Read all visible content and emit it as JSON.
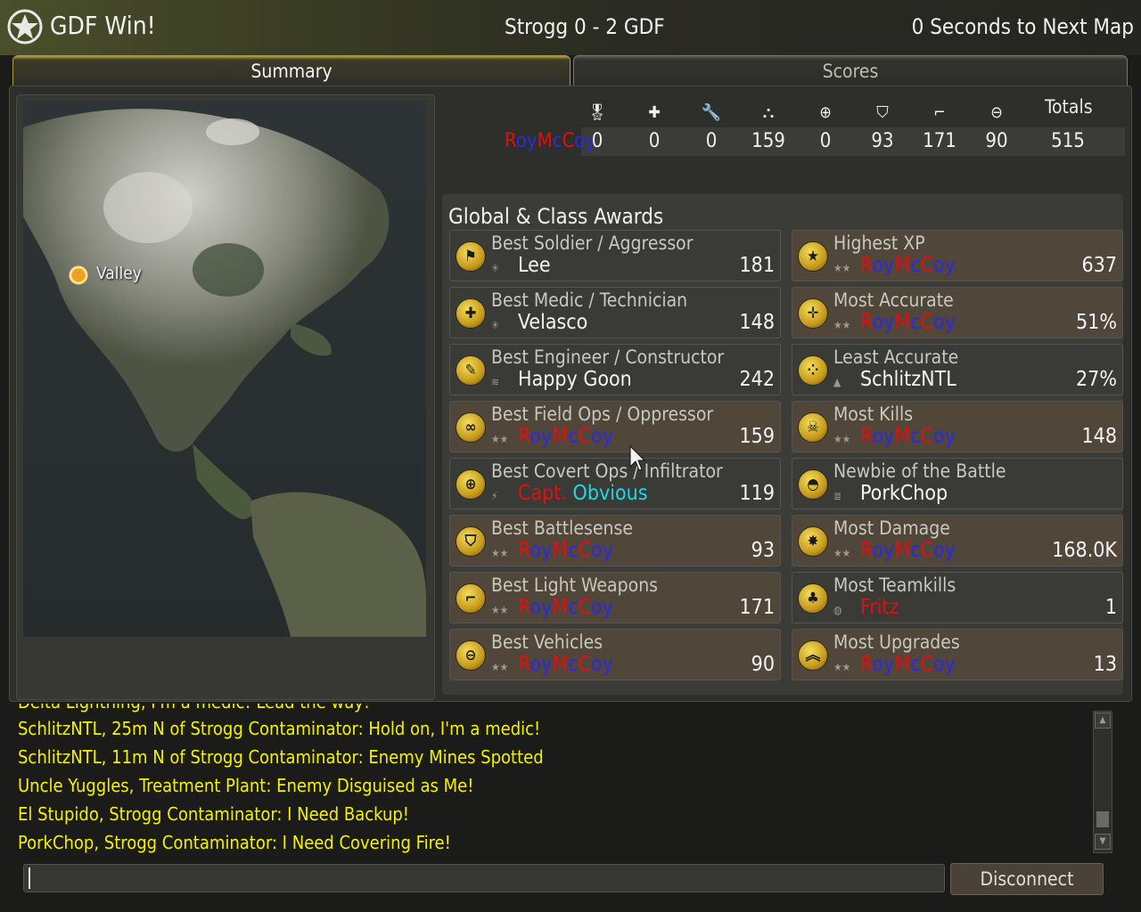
{
  "header": {
    "result": "GDF Win!",
    "match_score": "Strogg 0 - 2 GDF",
    "next_map": "0 Seconds to Next Map"
  },
  "tabs": [
    {
      "label": "Summary",
      "active": true
    },
    {
      "label": "Scores",
      "active": false
    }
  ],
  "map": {
    "location_label": "Valley"
  },
  "score_table": {
    "columns": [
      "soldier-icon",
      "medic-cross-icon",
      "wrench-icon",
      "binoculars-icon",
      "crosshair-icon",
      "shield-icon",
      "pistol-icon",
      "wheel-icon"
    ],
    "totals_label": "Totals",
    "player": {
      "name_parts": [
        {
          "text": "R",
          "color": "#e01010"
        },
        {
          "text": "oy",
          "color": "#2a2ae6"
        },
        {
          "text": "M",
          "color": "#e01010"
        },
        {
          "text": "c",
          "color": "#2a2ae6"
        },
        {
          "text": "C",
          "color": "#e01010"
        },
        {
          "text": "oy",
          "color": "#2a2ae6"
        }
      ],
      "values": [
        "0",
        "0",
        "0",
        "159",
        "0",
        "93",
        "171",
        "90"
      ],
      "total": "515"
    }
  },
  "awards": {
    "title": "Global & Class Awards",
    "left": [
      {
        "title": "Best Soldier / Aggressor",
        "player": "Lee",
        "value": "181",
        "rank_icon": "star-badge-icon",
        "icon": "soldier-icon",
        "alt": false
      },
      {
        "title": "Best Medic / Technician",
        "player": "Velasco",
        "value": "148",
        "rank_icon": "star-badge-icon",
        "icon": "medic-cross-icon",
        "alt": false
      },
      {
        "title": "Best Engineer / Constructor",
        "player": "Happy Goon",
        "value": "242",
        "rank_icon": "wings-badge-icon",
        "icon": "wrench-icon",
        "alt": false
      },
      {
        "title": "Best Field Ops / Oppressor",
        "player": "RoyMcCoy",
        "value": "159",
        "rank_icon": "two-stars-icon",
        "icon": "binoculars-icon",
        "alt": true
      },
      {
        "title": "Best Covert Ops / Infiltrator",
        "player": "Capt. Obvious",
        "value": "119",
        "rank_icon": "wing-badge-icon",
        "icon": "crosshair-icon",
        "alt": false
      },
      {
        "title": "Best Battlesense",
        "player": "RoyMcCoy",
        "value": "93",
        "rank_icon": "two-stars-icon",
        "icon": "shield-icon",
        "alt": true
      },
      {
        "title": "Best Light Weapons",
        "player": "RoyMcCoy",
        "value": "171",
        "rank_icon": "two-stars-icon",
        "icon": "pistol-icon",
        "alt": true
      },
      {
        "title": "Best Vehicles",
        "player": "RoyMcCoy",
        "value": "90",
        "rank_icon": "two-stars-icon",
        "icon": "wheel-icon",
        "alt": true
      }
    ],
    "right": [
      {
        "title": "Highest XP",
        "player": "RoyMcCoy",
        "value": "637",
        "rank_icon": "two-stars-icon",
        "icon": "star-icon",
        "alt": true
      },
      {
        "title": "Most Accurate",
        "player": "RoyMcCoy",
        "value": "51%",
        "rank_icon": "two-stars-icon",
        "icon": "target-icon",
        "alt": true
      },
      {
        "title": "Least Accurate",
        "player": "SchlitzNTL",
        "value": "27%",
        "rank_icon": "chevron-badge-icon",
        "icon": "dots-icon",
        "alt": false
      },
      {
        "title": "Most Kills",
        "player": "RoyMcCoy",
        "value": "148",
        "rank_icon": "two-stars-icon",
        "icon": "skull-icon",
        "alt": true
      },
      {
        "title": "Newbie of the Battle",
        "player": "PorkChop",
        "value": "",
        "rank_icon": "private-badge-icon",
        "icon": "helmet-icon",
        "alt": false
      },
      {
        "title": "Most Damage",
        "player": "RoyMcCoy",
        "value": "168.0K",
        "rank_icon": "two-stars-icon",
        "icon": "explosion-icon",
        "alt": true
      },
      {
        "title": "Most Teamkills",
        "player": "Fritz",
        "value": "1",
        "rank_icon": "globe-badge-icon",
        "icon": "tree-icon",
        "alt": false
      },
      {
        "title": "Most Upgrades",
        "player": "RoyMcCoy",
        "value": "13",
        "rank_icon": "two-stars-icon",
        "icon": "chevrons-up-icon",
        "alt": true
      }
    ]
  },
  "chat": {
    "partial_line": "Delta Lightning, I'm a medic! Lead the way!",
    "lines": [
      "SchlitzNTL, 25m N of Strogg Contaminator: Hold on, I'm a medic!",
      "SchlitzNTL, 11m N of Strogg Contaminator: Enemy Mines Spotted",
      "Uncle Yuggles, Treatment Plant: Enemy Disguised as Me!",
      "El Stupido, Strogg Contaminator: I Need Backup!",
      "PorkChop, Strogg Contaminator: I Need Covering Fire!"
    ],
    "input_value": ""
  },
  "buttons": {
    "disconnect": "Disconnect"
  }
}
